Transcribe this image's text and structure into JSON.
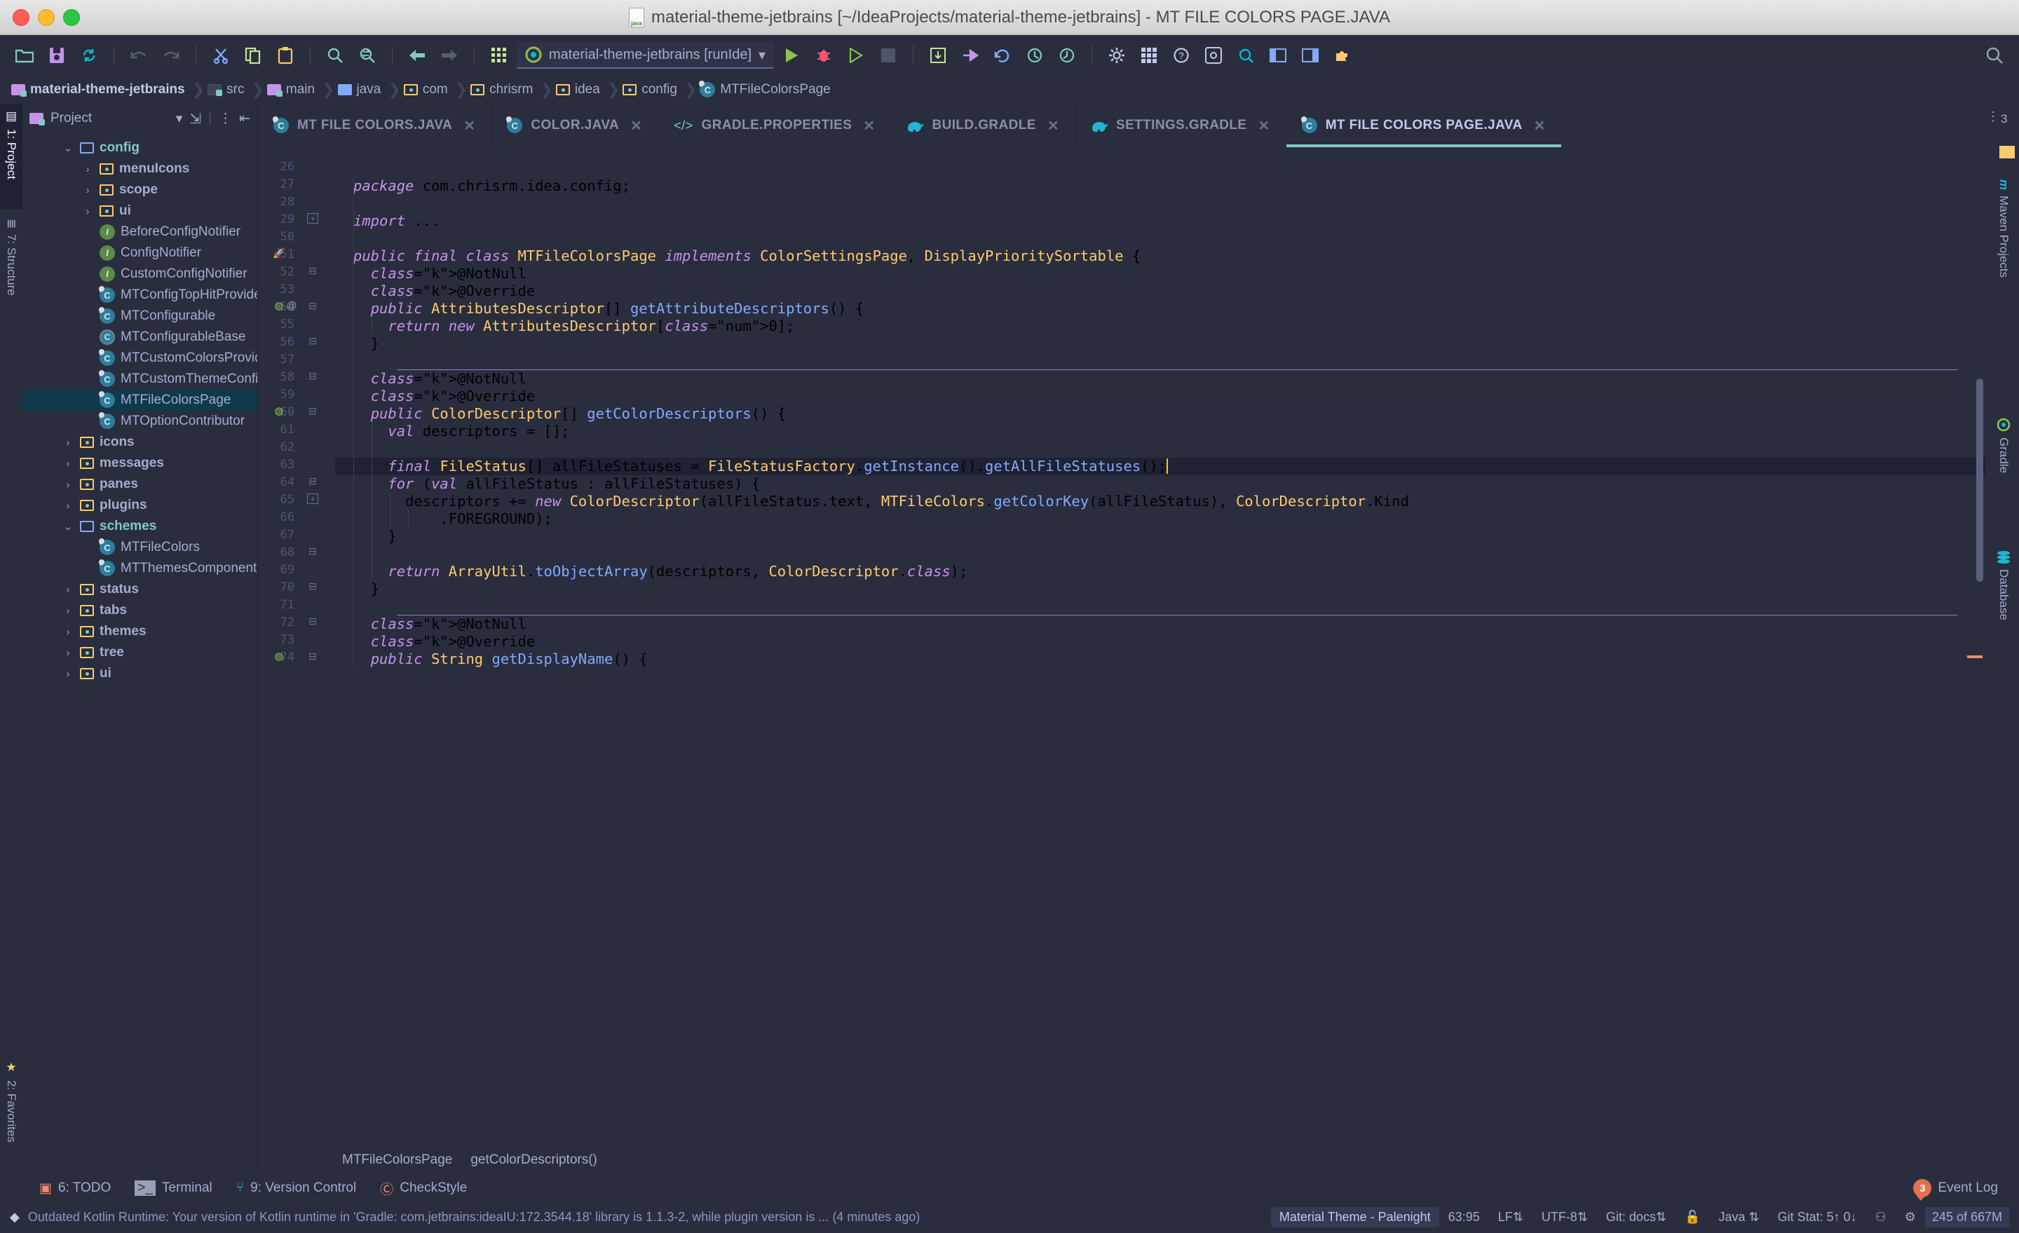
{
  "window": {
    "title": "material-theme-jetbrains [~/IdeaProjects/material-theme-jetbrains] - MT FILE COLORS PAGE.JAVA",
    "file_icon": "java-file-icon"
  },
  "toolbar": {
    "buttons": [
      {
        "name": "open-project-icon",
        "label": "Open"
      },
      {
        "name": "save-all-icon",
        "label": "Save All"
      },
      {
        "name": "sync-icon",
        "label": "Synchronize"
      },
      {
        "name": "undo-icon",
        "label": "Undo"
      },
      {
        "name": "redo-icon",
        "label": "Redo"
      },
      {
        "name": "cut-icon",
        "label": "Cut"
      },
      {
        "name": "copy-icon",
        "label": "Copy"
      },
      {
        "name": "paste-icon",
        "label": "Paste"
      },
      {
        "name": "find-icon",
        "label": "Find"
      },
      {
        "name": "replace-icon",
        "label": "Replace"
      },
      {
        "name": "back-icon",
        "label": "Back"
      },
      {
        "name": "forward-icon",
        "label": "Forward"
      },
      {
        "name": "apps-grid-icon",
        "label": "Modules"
      }
    ],
    "run_config": "material-theme-jetbrains [runIde]",
    "run_label": "Run",
    "debug_label": "Debug",
    "run_coverage_label": "Run with Coverage",
    "stop_label": "Stop",
    "right_buttons": [
      {
        "name": "update-project-icon",
        "label": "Update Project"
      },
      {
        "name": "commit-icon",
        "label": "Commit"
      },
      {
        "name": "rollback-icon",
        "label": "Rollback"
      },
      {
        "name": "history-icon",
        "label": "History"
      },
      {
        "name": "revert-icon",
        "label": "Revert"
      },
      {
        "name": "settings-gear-icon",
        "label": "Settings"
      },
      {
        "name": "apps-grid-icon",
        "label": "Layout"
      },
      {
        "name": "help-icon",
        "label": "Help"
      },
      {
        "name": "preferences-icon",
        "label": "Preferences"
      },
      {
        "name": "search-everywhere-icon",
        "label": "Search Everywhere"
      },
      {
        "name": "layout-left-icon",
        "label": "Layout Left"
      },
      {
        "name": "layout-right-icon",
        "label": "Layout Right"
      },
      {
        "name": "plugin-puzzle-icon",
        "label": "Plugins"
      }
    ],
    "magnifier_label": "Search"
  },
  "breadcrumbs": [
    {
      "label": "material-theme-jetbrains",
      "icon": "folder-module-icon"
    },
    {
      "label": "src",
      "icon": "folder-source-icon"
    },
    {
      "label": "main",
      "icon": "folder-module-icon"
    },
    {
      "label": "java",
      "icon": "folder-java-icon"
    },
    {
      "label": "com",
      "icon": "folder-package-icon"
    },
    {
      "label": "chrisrm",
      "icon": "folder-package-icon"
    },
    {
      "label": "idea",
      "icon": "folder-package-icon"
    },
    {
      "label": "config",
      "icon": "folder-package-icon"
    },
    {
      "label": "MTFileColorsPage",
      "icon": "java-class-icon"
    }
  ],
  "left_rail": [
    {
      "label": "1: Project",
      "icon": "project-icon",
      "active": true
    },
    {
      "label": "7: Structure",
      "icon": "structure-icon",
      "active": false
    },
    {
      "label": "2: Favorites",
      "icon": "star-icon",
      "active": false
    }
  ],
  "right_rail": [
    {
      "label": "Maven Projects",
      "icon": "maven-icon"
    },
    {
      "label": "Gradle",
      "icon": "gradle-icon"
    },
    {
      "label": "Database",
      "icon": "database-icon"
    }
  ],
  "project_panel": {
    "title": "Project",
    "collapse_label": "Collapse All",
    "options_label": "Options",
    "hide_label": "Hide",
    "tree": [
      {
        "label": "config",
        "depth": 1,
        "type": "folder-open",
        "arrow": "down",
        "style": "scheme"
      },
      {
        "label": "menuIcons",
        "depth": 2,
        "type": "folder-package",
        "arrow": "right",
        "style": "bold"
      },
      {
        "label": "scope",
        "depth": 2,
        "type": "folder-package",
        "arrow": "right",
        "style": "bold"
      },
      {
        "label": "ui",
        "depth": 2,
        "type": "folder-package",
        "arrow": "right",
        "style": "bold"
      },
      {
        "label": "BeforeConfigNotifier",
        "depth": 2,
        "type": "interface",
        "arrow": "",
        "style": ""
      },
      {
        "label": "ConfigNotifier",
        "depth": 2,
        "type": "interface",
        "arrow": "",
        "style": ""
      },
      {
        "label": "CustomConfigNotifier",
        "depth": 2,
        "type": "interface",
        "arrow": "",
        "style": ""
      },
      {
        "label": "MTConfigTopHitProvider",
        "depth": 2,
        "type": "class",
        "arrow": "",
        "style": ""
      },
      {
        "label": "MTConfigurable",
        "depth": 2,
        "type": "class",
        "arrow": "",
        "style": ""
      },
      {
        "label": "MTConfigurableBase",
        "depth": 2,
        "type": "abstract-class",
        "arrow": "",
        "style": ""
      },
      {
        "label": "MTCustomColorsProvider",
        "depth": 2,
        "type": "class",
        "arrow": "",
        "style": ""
      },
      {
        "label": "MTCustomThemeConfigurable",
        "depth": 2,
        "type": "class",
        "arrow": "",
        "style": ""
      },
      {
        "label": "MTFileColorsPage",
        "depth": 2,
        "type": "class",
        "arrow": "",
        "style": "",
        "selected": true
      },
      {
        "label": "MTOptionContributor",
        "depth": 2,
        "type": "class",
        "arrow": "",
        "style": ""
      },
      {
        "label": "icons",
        "depth": 1,
        "type": "folder-package",
        "arrow": "right",
        "style": "bold"
      },
      {
        "label": "messages",
        "depth": 1,
        "type": "folder-package",
        "arrow": "right",
        "style": "bold"
      },
      {
        "label": "panes",
        "depth": 1,
        "type": "folder-package",
        "arrow": "right",
        "style": "bold"
      },
      {
        "label": "plugins",
        "depth": 1,
        "type": "folder-package",
        "arrow": "right",
        "style": "bold"
      },
      {
        "label": "schemes",
        "depth": 1,
        "type": "folder-open",
        "arrow": "down",
        "style": "scheme"
      },
      {
        "label": "MTFileColors",
        "depth": 2,
        "type": "class",
        "arrow": "",
        "style": ""
      },
      {
        "label": "MTThemesComponent",
        "depth": 2,
        "type": "class",
        "arrow": "",
        "style": ""
      },
      {
        "label": "status",
        "depth": 1,
        "type": "folder-package",
        "arrow": "right",
        "style": "bold"
      },
      {
        "label": "tabs",
        "depth": 1,
        "type": "folder-package",
        "arrow": "right",
        "style": "bold"
      },
      {
        "label": "themes",
        "depth": 1,
        "type": "folder-package",
        "arrow": "right",
        "style": "bold"
      },
      {
        "label": "tree",
        "depth": 1,
        "type": "folder-package",
        "arrow": "right",
        "style": "bold"
      },
      {
        "label": "ui",
        "depth": 1,
        "type": "folder-package",
        "arrow": "right",
        "style": "bold"
      }
    ]
  },
  "editor_tabs": [
    {
      "label": "MT FILE COLORS.JAVA",
      "icon": "java-class-icon",
      "active": false
    },
    {
      "label": "COLOR.JAVA",
      "icon": "java-class-locked-icon",
      "active": false
    },
    {
      "label": "GRADLE.PROPERTIES",
      "icon": "properties-icon",
      "active": false
    },
    {
      "label": "BUILD.GRADLE",
      "icon": "gradle-elephant-icon",
      "active": false
    },
    {
      "label": "SETTINGS.GRADLE",
      "icon": "gradle-elephant-icon",
      "active": false
    },
    {
      "label": "MT FILE COLORS PAGE.JAVA",
      "icon": "java-class-icon",
      "active": true
    }
  ],
  "code": {
    "first_line": 26,
    "lines": [
      {
        "n": 26,
        "text": ""
      },
      {
        "n": 27,
        "text": "package com.chrisrm.idea.config;"
      },
      {
        "n": 28,
        "text": ""
      },
      {
        "n": 29,
        "text": "import ..."
      },
      {
        "n": 50,
        "text": ""
      },
      {
        "n": 51,
        "text": "public final class MTFileColorsPage implements ColorSettingsPage, DisplayPrioritySortable {"
      },
      {
        "n": 52,
        "text": "  @NotNull"
      },
      {
        "n": 53,
        "text": "  @Override"
      },
      {
        "n": 54,
        "text": "  public AttributesDescriptor[] getAttributeDescriptors() {"
      },
      {
        "n": 55,
        "text": "    return new AttributesDescriptor[0];"
      },
      {
        "n": 56,
        "text": "  }"
      },
      {
        "n": 57,
        "text": ""
      },
      {
        "n": 58,
        "text": "  @NotNull"
      },
      {
        "n": 59,
        "text": "  @Override"
      },
      {
        "n": 60,
        "text": "  public ColorDescriptor[] getColorDescriptors() {"
      },
      {
        "n": 61,
        "text": "    val descriptors = [];"
      },
      {
        "n": 62,
        "text": ""
      },
      {
        "n": 63,
        "text": "    final FileStatus[] allFileStatuses = FileStatusFactory.getInstance().getAllFileStatuses();"
      },
      {
        "n": 64,
        "text": "    for (val allFileStatus : allFileStatuses) {"
      },
      {
        "n": 65,
        "text": "      descriptors += new ColorDescriptor(allFileStatus.text, MTFileColors.getColorKey(allFileStatus), ColorDescriptor.Kind"
      },
      {
        "n": 66,
        "text": "          .FOREGROUND);"
      },
      {
        "n": 67,
        "text": "    }"
      },
      {
        "n": 68,
        "text": ""
      },
      {
        "n": 69,
        "text": "    return ArrayUtil.toObjectArray(descriptors, ColorDescriptor.class);"
      },
      {
        "n": 70,
        "text": "  }"
      },
      {
        "n": 71,
        "text": ""
      },
      {
        "n": 72,
        "text": "  @NotNull"
      },
      {
        "n": 73,
        "text": "  @Override"
      },
      {
        "n": 74,
        "text": "  public String getDisplayName() {"
      }
    ],
    "cursor_line": 63,
    "inspection_count": "3"
  },
  "editor_breadcrumb": {
    "class": "MTFileColorsPage",
    "method": "getColorDescriptors()"
  },
  "bottom_tabs": [
    {
      "label": "6: TODO",
      "icon": "todo-icon"
    },
    {
      "label": "Terminal",
      "icon": "terminal-icon"
    },
    {
      "label": "9: Version Control",
      "icon": "branch-icon"
    },
    {
      "label": "CheckStyle",
      "icon": "checkstyle-icon"
    }
  ],
  "status_bar": {
    "message": "Outdated Kotlin Runtime: Your version of Kotlin runtime in 'Gradle: com.jetbrains:ideaIU:172.3544.18' library is 1.1.3-2, while plugin version is ... (4 minutes ago)",
    "theme": "Material Theme - Palenight",
    "caret": "63:95",
    "line_separator": "LF",
    "encoding": "UTF-8",
    "branch": "Git: docs",
    "lock_icon": "lock-icon",
    "language": "Java",
    "git_stat": "Git Stat: 5↑ 0↓",
    "hector_icon": "hector-icon",
    "inspection_icon": "inspection-gear-icon",
    "memory": "245 of 667M",
    "event_log_label": "Event Log",
    "event_log_count": "3"
  },
  "colors": {
    "background": "#292D3E",
    "accent": "#80CBC4",
    "selection": "#0F3A4B",
    "keyword": "#C792EA",
    "type": "#FFCB6B",
    "method": "#82AAFF",
    "string": "#C3E88D",
    "number": "#F78C6C",
    "foreground": "#A6ACCD"
  }
}
